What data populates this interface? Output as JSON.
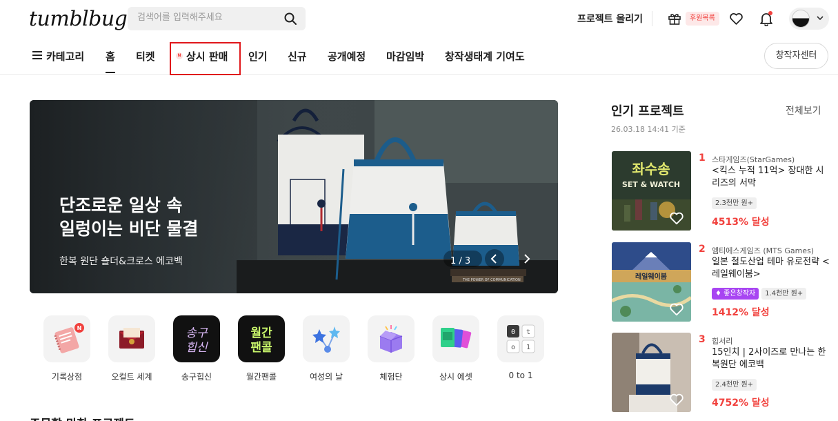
{
  "header": {
    "logo": "tumblbug",
    "search_placeholder": "검색어를 입력해주세요",
    "upload_project": "프로젝트 올리기",
    "sponsor_list": "후원목록"
  },
  "nav": {
    "items": [
      "카테고리",
      "홈",
      "티켓",
      "상시 판매",
      "인기",
      "신규",
      "공개예정",
      "마감임박",
      "창작생태계 기여도"
    ],
    "new_badge": "N",
    "creator_center": "창작자센터"
  },
  "banner": {
    "title_line1": "단조로운 일상 속",
    "title_line2": "일렁이는 비단 물결",
    "subtitle": "한복 원단 숄더&크로스 에코백",
    "counter": "1 / 3",
    "book_text": "THE POWER OF COMMUNICATION"
  },
  "categories": [
    {
      "label": "기록상점",
      "icon": "notebook-icon"
    },
    {
      "label": "오컬트 세계",
      "icon": "envelope-icon"
    },
    {
      "label": "송구힙신",
      "icon": "songgu-hipsin-logo",
      "tile_text": "송구\n힙신"
    },
    {
      "label": "월간팬콜",
      "icon": "monthly-fancall-logo",
      "tile_text": "월간\n팬콜"
    },
    {
      "label": "여성의 날",
      "icon": "stars-icon"
    },
    {
      "label": "체험단",
      "icon": "gift-box-icon"
    },
    {
      "label": "상시 에셋",
      "icon": "cards-icon"
    },
    {
      "label": "0 to 1",
      "icon": "keyboard-keys-icon"
    }
  ],
  "popular": {
    "title": "인기 프로젝트",
    "view_all": "전체보기",
    "timestamp": "26.03.18 14:41 기준",
    "items": [
      {
        "rank": "1",
        "maker": "스타게임즈(StarGames)",
        "name": "<킥스 누적 11억> 장대한 시리즈의 서막",
        "tags": [
          "2.3천만 원+"
        ],
        "funded": "4513% 달성",
        "thumb_title": "좌수송",
        "thumb_sub": "SET & WATCH"
      },
      {
        "rank": "2",
        "maker": "엠티에스게임즈 (MTS Games)",
        "name": "일본 철도산업 테마 유로전략 <레일웨이붐>",
        "tags": [
          "♦ 좋은창작자",
          "1.4천만 원+"
        ],
        "funded": "1412% 달성",
        "thumb_title": "레일웨이붐"
      },
      {
        "rank": "3",
        "maker": "힙서리",
        "name": "15인치 | 2사이즈로 만나는 한복원단 에코백",
        "tags": [
          "2.4천만 원+"
        ],
        "funded": "4752% 달성"
      }
    ]
  },
  "section_peek": "주목할 만한 프로젝트",
  "colors": {
    "accent": "#f1413d",
    "highlight_box": "#e0161a",
    "good_creator": "#a845f2"
  }
}
